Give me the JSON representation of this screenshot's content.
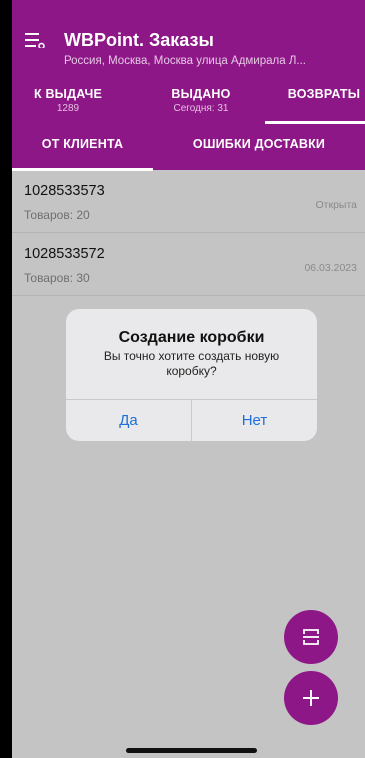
{
  "header": {
    "title": "WBPoint. Заказы",
    "subtitle": "Россия, Москва, Москва улица Адмирала Л..."
  },
  "tabs": [
    {
      "label": "К ВЫДАЧЕ",
      "count": "1289"
    },
    {
      "label": "ВЫДАНО",
      "count": "Сегодня: 31"
    },
    {
      "label": "ВОЗВРАТЫ",
      "count": ""
    }
  ],
  "subtabs": [
    {
      "label": "ОТ КЛИЕНТА"
    },
    {
      "label": "ОШИБКИ ДОСТАВКИ"
    }
  ],
  "list": [
    {
      "id": "1028533573",
      "count": "Товаров: 20",
      "status": "Открыта"
    },
    {
      "id": "1028533572",
      "count": "Товаров: 30",
      "status": "06.03.2023"
    }
  ],
  "dialog": {
    "title": "Создание коробки",
    "message": "Вы точно хотите создать новую коробку?",
    "yes_label": "Да",
    "no_label": "Нет"
  },
  "fabs": [
    {
      "icon": "box-scan-icon"
    },
    {
      "icon": "plus-icon"
    }
  ],
  "colors": {
    "brand": "#8e1787",
    "link": "#1e6fd9"
  }
}
